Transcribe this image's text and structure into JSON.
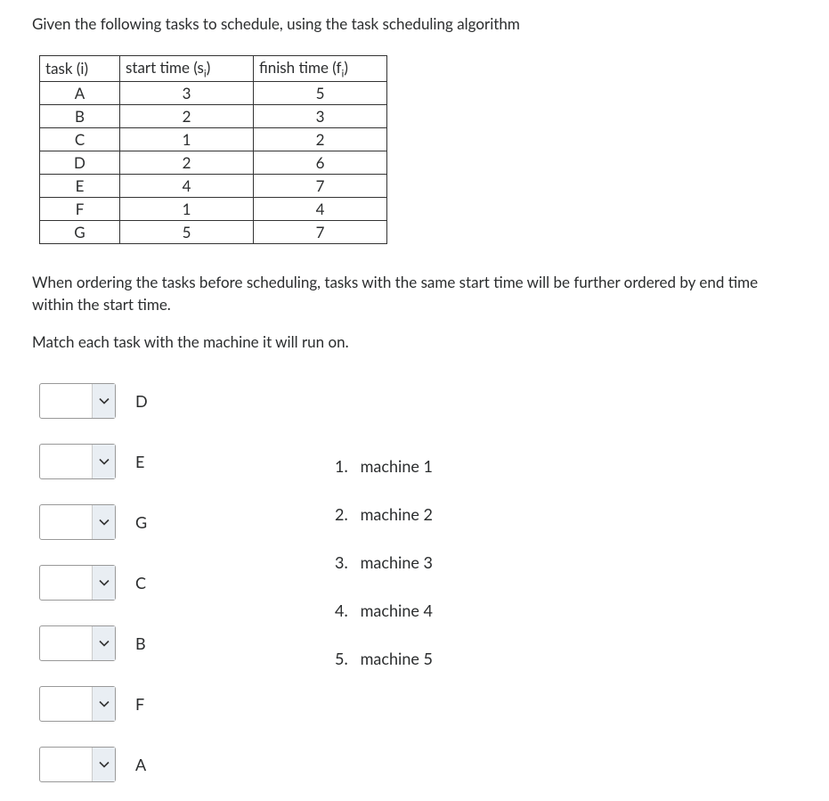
{
  "prompt": "Given the following tasks to schedule, using the task scheduling algorithm",
  "table": {
    "headers": {
      "task": "task (i)",
      "start": "start time (s",
      "start_sub": "i",
      "start_close": ")",
      "finish": "finish time (f",
      "finish_sub": "i",
      "finish_close": ")"
    },
    "rows": [
      {
        "task": "A",
        "start": "3",
        "finish": "5"
      },
      {
        "task": "B",
        "start": "2",
        "finish": "3"
      },
      {
        "task": "C",
        "start": "1",
        "finish": "2"
      },
      {
        "task": "D",
        "start": "2",
        "finish": "6"
      },
      {
        "task": "E",
        "start": "4",
        "finish": "7"
      },
      {
        "task": "F",
        "start": "1",
        "finish": "4"
      },
      {
        "task": "G",
        "start": "5",
        "finish": "7"
      }
    ]
  },
  "explain": "When ordering the tasks before scheduling, tasks with the same start time will be further ordered by end time within the start time.",
  "instruct": "Match each task with the machine it will run on.",
  "left_items": [
    "D",
    "E",
    "G",
    "C",
    "B",
    "F",
    "A"
  ],
  "answers": [
    {
      "num": "1.",
      "label": "machine 1"
    },
    {
      "num": "2.",
      "label": "machine 2"
    },
    {
      "num": "3.",
      "label": "machine 3"
    },
    {
      "num": "4.",
      "label": "machine 4"
    },
    {
      "num": "5.",
      "label": "machine 5"
    }
  ]
}
